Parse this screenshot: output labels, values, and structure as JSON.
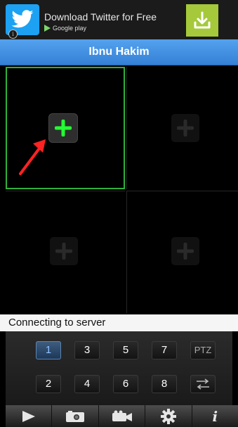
{
  "ad": {
    "title": "Download Twitter for Free",
    "subtitle": "Google play",
    "info_glyph": "i"
  },
  "header": {
    "title": "Ibnu Hakim"
  },
  "grid": {
    "cells": [
      {
        "state": "selected"
      },
      {
        "state": "empty"
      },
      {
        "state": "empty"
      },
      {
        "state": "empty"
      }
    ]
  },
  "status": {
    "text": "Connecting to server"
  },
  "channels": {
    "row1": [
      "1",
      "3",
      "5",
      "7"
    ],
    "row2": [
      "2",
      "4",
      "6",
      "8"
    ],
    "ptz_label": "PTZ",
    "active": "1"
  },
  "toolbar": {
    "items": [
      "play-icon",
      "camera-icon",
      "video-record-icon",
      "settings-gear-icon",
      "info-icon"
    ],
    "info_glyph": "i"
  },
  "colors": {
    "accent_blue": "#3b8ae0",
    "selection_green": "#2fb03a",
    "ad_download_green": "#a5c93a",
    "twitter_blue": "#1da1f2"
  }
}
